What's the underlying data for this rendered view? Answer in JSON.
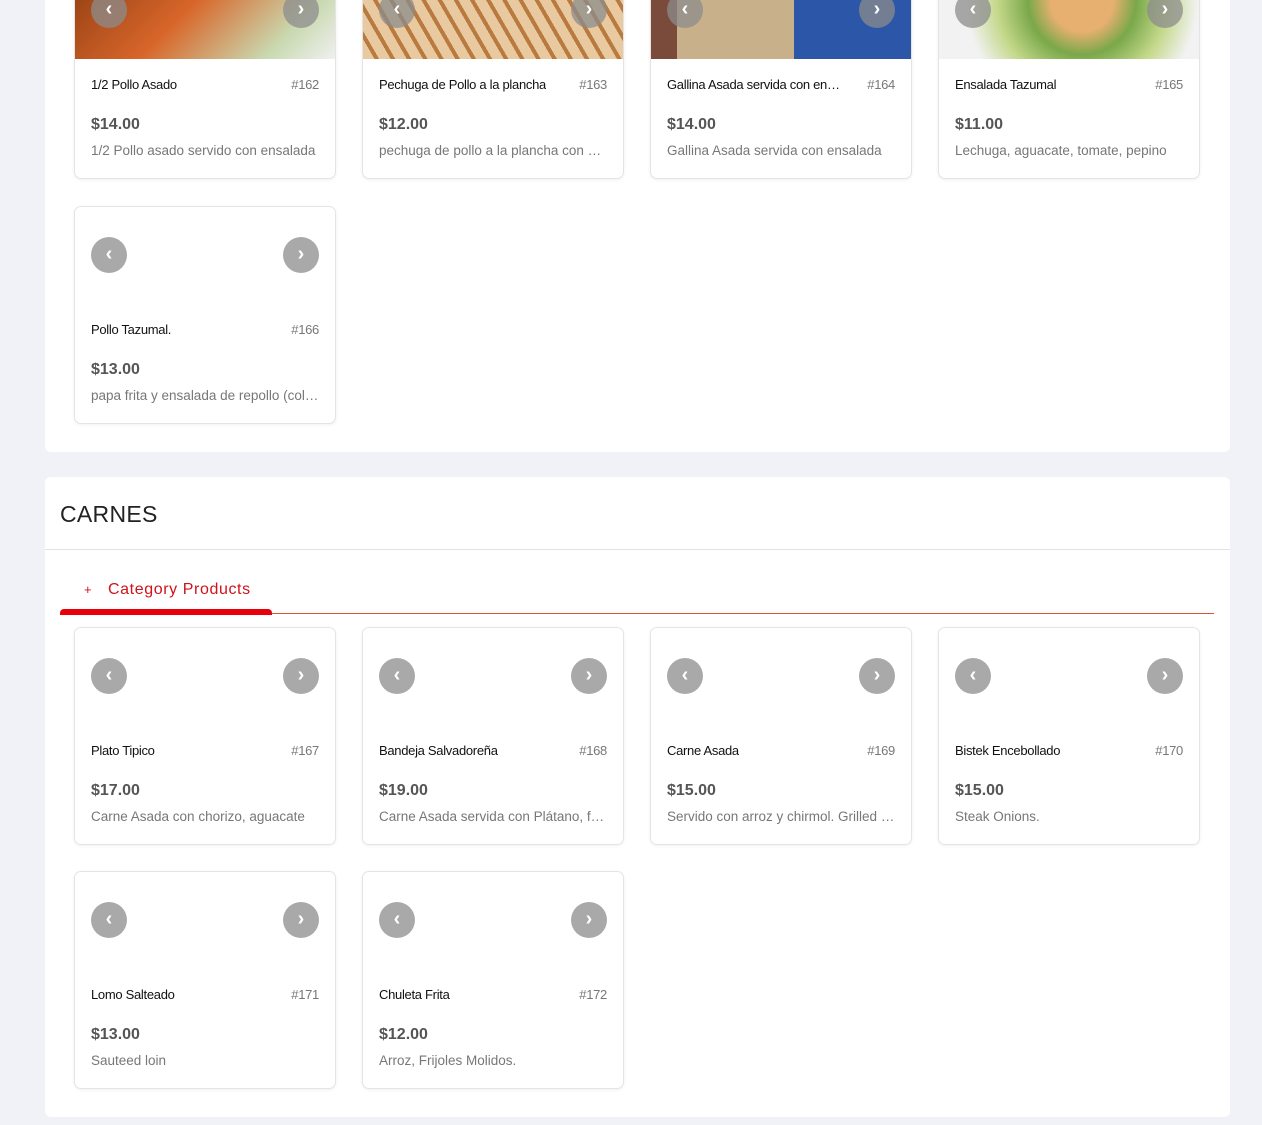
{
  "sections": [
    {
      "products": [
        {
          "name": "1/2 Pollo Asado",
          "number": "#162",
          "price": "$14.00",
          "description": "1/2 Pollo asado servido con ensalada",
          "image": "linear-gradient(135deg,#8a3b10,#d8662a 45%,#c9d9b0 80%,#f0f0f0)"
        },
        {
          "name": "Pechuga de Pollo a la plancha",
          "number": "#163",
          "price": "$12.00",
          "description": "pechuga de pollo a la plancha con arroz",
          "image": "repeating-linear-gradient(60deg,#e8c9a0 0 10px,#b97a3f 10px 14px)"
        },
        {
          "name": "Gallina Asada servida con ensalada",
          "number": "#164",
          "price": "$14.00",
          "description": "Gallina Asada servida con ensalada",
          "image": "linear-gradient(90deg,#7a4a3a 0 10%,#c8b08a 10% 55%,#2c56a8 55%)"
        },
        {
          "name": "Ensalada Tazumal",
          "number": "#165",
          "price": "$11.00",
          "description": "Lechuga, aguacate, tomate, pepino",
          "image": "radial-gradient(circle at 55% 40%,#e8b070 0 20%,#7aa84a 35%,#c4d88a 55%,#f2f2f2 75%)"
        },
        {
          "name": "Pollo Tazumal.",
          "number": "#166",
          "price": "$13.00",
          "description": "papa frita y ensalada de repollo (cole slaw)",
          "image": "#fff"
        }
      ]
    },
    {
      "title": "CARNES",
      "tab_label": "Category Products",
      "tab_icon": "+",
      "products": [
        {
          "name": "Plato Tipico",
          "number": "#167",
          "price": "$17.00",
          "description": "Carne Asada con chorizo, aguacate",
          "image": "#fff"
        },
        {
          "name": "Bandeja Salvadoreña",
          "number": "#168",
          "price": "$19.00",
          "description": "Carne Asada servida con Plátano, frijoles",
          "image": "#fff"
        },
        {
          "name": "Carne Asada",
          "number": "#169",
          "price": "$15.00",
          "description": "Servido con arroz y chirmol. Grilled steak",
          "image": "#fff"
        },
        {
          "name": "Bistek Encebollado",
          "number": "#170",
          "price": "$15.00",
          "description": "Steak Onions.",
          "image": "#fff"
        },
        {
          "name": "Lomo Salteado",
          "number": "#171",
          "price": "$13.00",
          "description": "Sauteed loin",
          "image": "#fff"
        },
        {
          "name": "Chuleta Frita",
          "number": "#172",
          "price": "$12.00",
          "description": "Arroz, Frijoles Molidos.",
          "image": "#fff"
        }
      ]
    }
  ],
  "arrows": {
    "prev": "‹",
    "next": "›"
  }
}
